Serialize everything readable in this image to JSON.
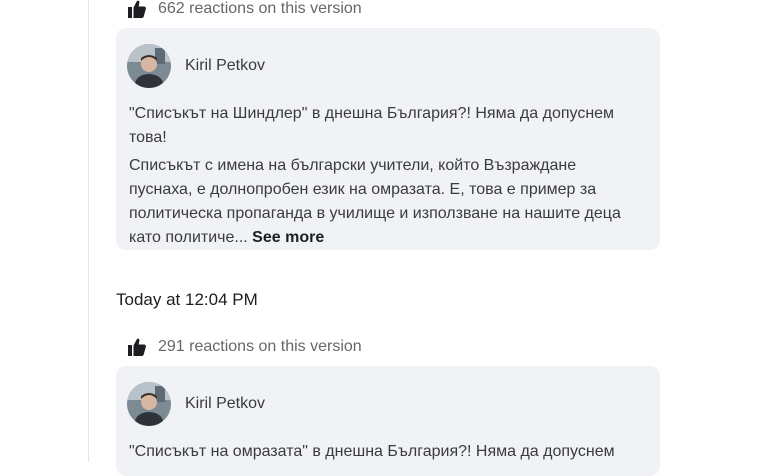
{
  "versions": [
    {
      "reactions_text": "662 reactions on this version",
      "author": "Kiril Petkov",
      "title": "\"Списъкът на Шиндлер\" в днешна България?! Няма да допуснем това!",
      "body": "Списъкът с имена на български учители, който Възраждане пуснаха, е долнопробен език на омразата. Е, това е пример за политическа пропаганда в училище и използване на нашите деца като политиче...",
      "see_more": "See more"
    },
    {
      "timestamp": "Today at 12:04 PM",
      "reactions_text": "291 reactions on this version",
      "author": "Kiril Petkov",
      "title": "\"Списъкът на омразата\" в днешна България?! Няма да допуснем"
    }
  ],
  "icons": {
    "reaction": "thumbs-up-icon"
  },
  "colors": {
    "card_background": "#f0f2f5",
    "secondary_text": "#65676b"
  }
}
